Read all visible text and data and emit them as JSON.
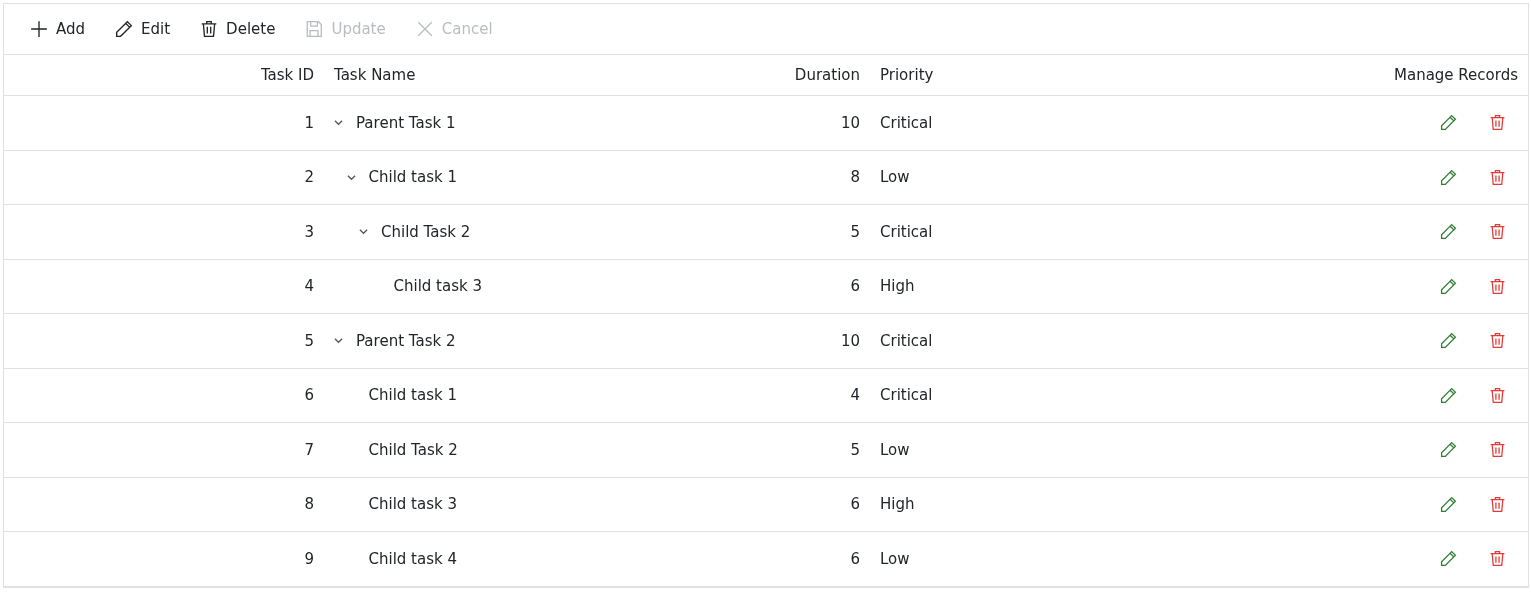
{
  "toolbar": [
    {
      "kind": "add",
      "label": "Add",
      "disabled": false
    },
    {
      "kind": "edit",
      "label": "Edit",
      "disabled": false
    },
    {
      "kind": "delete",
      "label": "Delete",
      "disabled": false
    },
    {
      "kind": "update",
      "label": "Update",
      "disabled": true
    },
    {
      "kind": "cancel",
      "label": "Cancel",
      "disabled": true
    }
  ],
  "table": {
    "columns": [
      "Task ID",
      "Task Name",
      "Duration",
      "Priority",
      "Manage Records"
    ],
    "rows": [
      {
        "id": "1",
        "name": "Parent Task 1",
        "duration": "10",
        "priority": "Critical",
        "expanded": true,
        "children": [
          {
            "id": "2",
            "name": "Child task 1",
            "duration": "8",
            "priority": "Low",
            "expanded": true,
            "children": [
              {
                "id": "3",
                "name": "Child Task 2",
                "duration": "5",
                "priority": "Critical",
                "expanded": true,
                "children": [
                  {
                    "id": "4",
                    "name": "Child task 3",
                    "duration": "6",
                    "priority": "High"
                  }
                ]
              }
            ]
          }
        ]
      },
      {
        "id": "5",
        "name": "Parent Task 2",
        "duration": "10",
        "priority": "Critical",
        "expanded": true,
        "children": [
          {
            "id": "6",
            "name": "Child task 1",
            "duration": "4",
            "priority": "Critical"
          },
          {
            "id": "7",
            "name": "Child Task 2",
            "duration": "5",
            "priority": "Low"
          },
          {
            "id": "8",
            "name": "Child task 3",
            "duration": "6",
            "priority": "High"
          },
          {
            "id": "9",
            "name": "Child task 4",
            "duration": "6",
            "priority": "Low"
          }
        ]
      }
    ]
  }
}
